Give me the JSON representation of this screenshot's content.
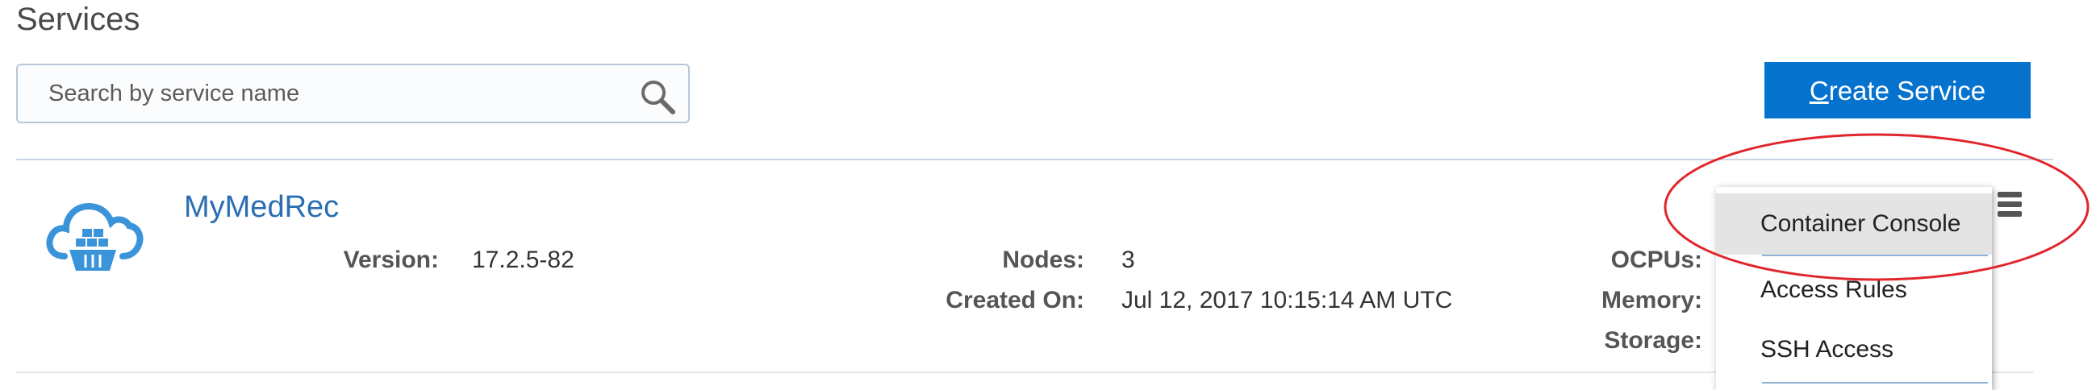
{
  "page": {
    "title": "Services"
  },
  "search": {
    "placeholder": "Search by service name",
    "icon": "search-icon"
  },
  "toolbar": {
    "create_label_accel": "C",
    "create_label_rest": "reate Service",
    "create_color": "#0572ce"
  },
  "service": {
    "icon": "cloud-container-icon",
    "name": "MyMedRec",
    "version_label": "Version:",
    "version_value": "17.2.5-82",
    "nodes_label": "Nodes:",
    "nodes_value": "3",
    "created_label": "Created On:",
    "created_value": "Jul 12, 2017 10:15:14 AM UTC",
    "ocpus_label": "OCPUs:",
    "memory_label": "Memory:",
    "storage_label": "Storage:"
  },
  "menu": {
    "icon": "hamburger-menu-icon",
    "items": [
      {
        "label": "Container Console"
      },
      {
        "label": "Access Rules"
      },
      {
        "label": "SSH Access"
      }
    ]
  },
  "colors": {
    "link": "#2a6eb3",
    "annotation": "#e0262b"
  }
}
